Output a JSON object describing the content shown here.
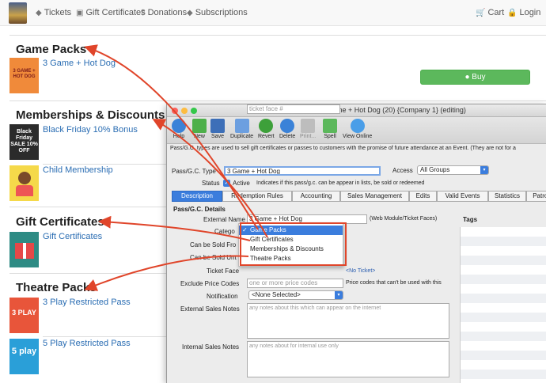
{
  "nav": {
    "links": [
      {
        "label": "Tickets",
        "icon": "tag-icon"
      },
      {
        "label": "Gift Certificates",
        "icon": "gift-icon"
      },
      {
        "label": "Donations",
        "icon": "dollar-icon"
      },
      {
        "label": "Subscriptions",
        "icon": "tag-icon"
      },
      {
        "label": "Cart",
        "icon": "cart-icon"
      },
      {
        "label": "Login",
        "icon": "lock-icon"
      }
    ]
  },
  "sections": [
    {
      "title": "Game Packs",
      "items": [
        {
          "label": "3 Game + Hot Dog",
          "thumb": "3 GAME + HOT DOG"
        }
      ]
    },
    {
      "title": "Memberships & Discounts",
      "items": [
        {
          "label": "Black Friday 10% Bonus",
          "thumb": "Black Friday SALE 10% OFF"
        },
        {
          "label": "Child Membership",
          "thumb": ""
        }
      ]
    },
    {
      "title": "Gift Certificates",
      "items": [
        {
          "label": "Gift Certificates",
          "thumb": ""
        }
      ]
    },
    {
      "title": "Theatre Packs",
      "items": [
        {
          "label": "3 Play Restricted Pass",
          "thumb": "3 PLAY"
        },
        {
          "label": "5 Play Restricted Pass",
          "thumb": "5 play"
        }
      ]
    }
  ],
  "buy_label": "Buy",
  "dialog": {
    "title": "Pass/G.C. Detail - 3 Game + Hot Dog (20) {Company 1} (editing)",
    "toolbar": [
      "Help",
      "New",
      "Save",
      "Duplicate",
      "Revert",
      "Delete",
      "Print...",
      "Spell",
      "View Online"
    ],
    "description": "Pass/G.C. types are used to sell gift certificates or passes to customers with the promise of future attendance at an Event.  (They are not for a",
    "type_label": "Pass/G.C. Type",
    "type_value": "3 Game + Hot Dog",
    "access_label": "Access",
    "access_value": "All Groups",
    "status_label": "Status",
    "active_label": "Active",
    "status_hint": "Indicates if this pass/g.c. can be appear in lists, be sold or redeemed",
    "tabs": [
      "Description",
      "Redemption Rules",
      "Accounting",
      "Sales Management",
      "Edits",
      "Valid Events",
      "Statistics",
      "Patron"
    ],
    "details_header": "Pass/G.C. Details",
    "external_name_label": "External Name",
    "external_name_value": "3 Game + Hot Dog",
    "external_name_hint": "(Web Module/Ticket Faces)",
    "tags_label": "Tags",
    "category_label": "Catego",
    "category_options": [
      "Game Packs",
      "Gift Certificates",
      "Memberships & Discounts",
      "Theatre Packs"
    ],
    "category_selected": "Game Packs",
    "sold_from_label": "Can be Sold Fro",
    "sold_until_label": "Can be Sold Unt",
    "ticket_face_label": "Ticket Face",
    "ticket_face_placeholder": "ticket face #",
    "no_ticket": "<No Ticket>",
    "excl_label": "Exclude Price Codes",
    "excl_placeholder": "one or more price codes",
    "excl_hint": "Price codes that can't be used with this",
    "notification_label": "Notification",
    "notification_value": "<None Selected>",
    "ext_notes_label": "External Sales Notes",
    "ext_notes_placeholder": "any notes about this which can appear on the internet",
    "int_notes_label": "Internal Sales Notes",
    "int_notes_placeholder": "any notes about for internal use only"
  },
  "colors": {
    "accent": "#3b7ddd",
    "link": "#2a6db3",
    "buy": "#5cb85c",
    "annotation": "#e0452a"
  }
}
